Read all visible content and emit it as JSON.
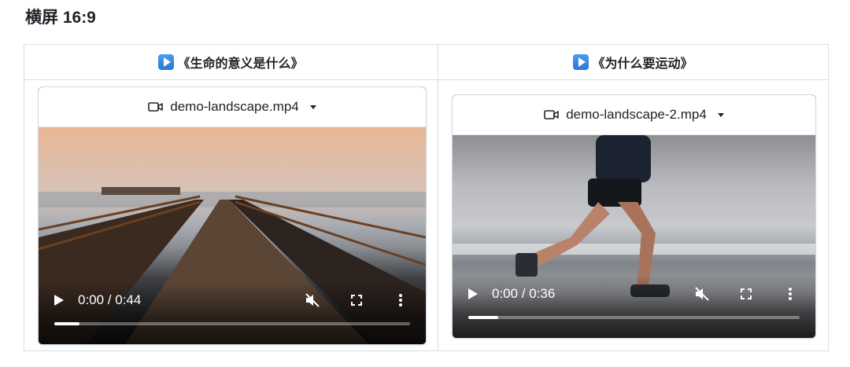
{
  "heading": "横屏 16:9",
  "columns": [
    {
      "title": "《生命的意义是什么》",
      "title_icon": "play-button-icon",
      "video": {
        "filename": "demo-landscape.mp4",
        "time": "0:00 / 0:44",
        "progress": 0.07,
        "scene": "wooden pier over sea at sunset"
      }
    },
    {
      "title": "《为什么要运动》",
      "title_icon": "play-button-icon",
      "video": {
        "filename": "demo-landscape-2.mp4",
        "time": "0:00 / 0:36",
        "progress": 0.09,
        "scene": "runner on a beach"
      }
    }
  ]
}
